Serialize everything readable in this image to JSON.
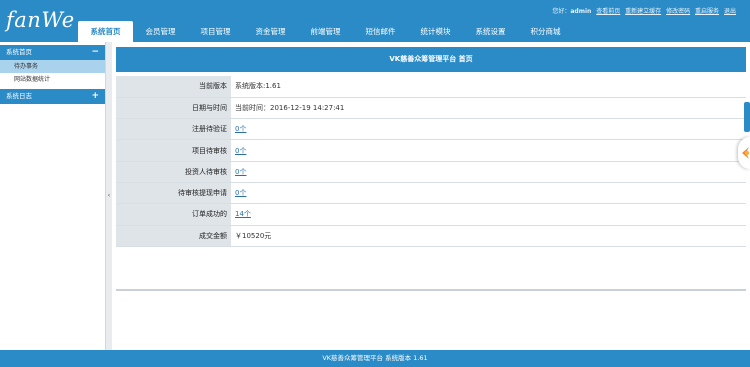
{
  "header": {
    "logo": "fanWe",
    "greeting": "您好：",
    "username": "admin",
    "links": [
      "查看前页",
      "重新建立缓存",
      "修改密码",
      "重启服务",
      "退出"
    ],
    "nav": [
      {
        "label": "系统首页",
        "active": true
      },
      {
        "label": "会员管理",
        "active": false
      },
      {
        "label": "项目管理",
        "active": false
      },
      {
        "label": "资金管理",
        "active": false
      },
      {
        "label": "前端管理",
        "active": false
      },
      {
        "label": "短信邮件",
        "active": false
      },
      {
        "label": "统计模块",
        "active": false
      },
      {
        "label": "系统设置",
        "active": false
      },
      {
        "label": "积分商城",
        "active": false
      }
    ]
  },
  "sidebar": {
    "group1": {
      "label": "系统首页",
      "sign": "−"
    },
    "items": [
      {
        "label": "待办事务",
        "active": true
      },
      {
        "label": "网站数据统计",
        "active": false
      }
    ],
    "group2": {
      "label": "系统日志",
      "sign": "+"
    },
    "collapse_handle": "‹"
  },
  "main": {
    "title": "VK慈善众筹管理平台 首页",
    "rows": [
      {
        "label": "当前版本",
        "value": "系统版本:1.61",
        "link": false
      },
      {
        "label": "日期与时间",
        "value": "当前时间：2016-12-19 14:27:41",
        "link": false
      },
      {
        "label": "注册待验证",
        "value": "0个",
        "link": true
      },
      {
        "label": "项目待审核",
        "value": "0个",
        "link": true
      },
      {
        "label": "投资人待审核",
        "value": "0个",
        "link": true
      },
      {
        "label": "待审核提现申请",
        "value": "0个",
        "link": true
      },
      {
        "label": "订单成功的",
        "value": "14个",
        "link": true
      },
      {
        "label": "成交金额",
        "value": "￥10520元",
        "link": false
      }
    ]
  },
  "footer": {
    "text": "VK慈善众筹管理平台 系统版本 1.61"
  },
  "colors": {
    "brand": "#2a8bc7",
    "label_bg": "#dfe4e8",
    "sidebar_active": "#a9d3ed",
    "link": "#2a6fa8"
  }
}
